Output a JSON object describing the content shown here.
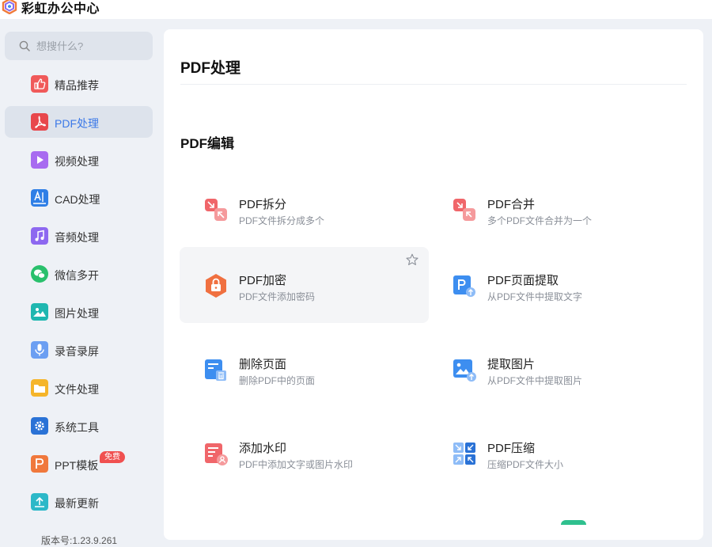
{
  "app": {
    "title": "彩虹办公中心"
  },
  "search": {
    "placeholder": "想搜什么?"
  },
  "sidebar": {
    "items": [
      {
        "label": "精品推荐",
        "icon": "thumbs-up-icon",
        "color": "#f05a5a"
      },
      {
        "label": "PDF处理",
        "icon": "pdf-icon",
        "color": "#e8474c",
        "active": true
      },
      {
        "label": "视频处理",
        "icon": "video-play-icon",
        "color": "#a86bf0"
      },
      {
        "label": "CAD处理",
        "icon": "cad-icon",
        "color": "#2f7fe6"
      },
      {
        "label": "音频处理",
        "icon": "music-note-icon",
        "color": "#8d68f0"
      },
      {
        "label": "微信多开",
        "icon": "wechat-icon",
        "color": "#29c06c"
      },
      {
        "label": "图片处理",
        "icon": "image-icon",
        "color": "#1fb7b0"
      },
      {
        "label": "录音录屏",
        "icon": "microphone-icon",
        "color": "#6c9ff2"
      },
      {
        "label": "文件处理",
        "icon": "folder-icon",
        "color": "#f5b52a"
      },
      {
        "label": "系统工具",
        "icon": "gear-icon",
        "color": "#2a72d6"
      },
      {
        "label": "PPT模板",
        "icon": "ppt-icon",
        "color": "#f0783c",
        "badge": "免费"
      },
      {
        "label": "最新更新",
        "icon": "upload-icon",
        "color": "#2cb8c8"
      }
    ],
    "version": "版本号:1.23.9.261"
  },
  "main": {
    "title": "PDF处理",
    "section": "PDF编辑",
    "tools": [
      {
        "title": "PDF拆分",
        "desc": "PDF文件拆分成多个",
        "icon": "pdf-split-icon",
        "color": "#f0666a"
      },
      {
        "title": "PDF合并",
        "desc": "多个PDF文件合并为一个",
        "icon": "pdf-merge-icon",
        "color": "#f0666a"
      },
      {
        "title": "PDF加密",
        "desc": "PDF文件添加密码",
        "icon": "pdf-lock-icon",
        "color": "#f07040"
      },
      {
        "title": "PDF页面提取",
        "desc": "从PDF文件中提取文字",
        "icon": "pdf-page-extract-icon",
        "color": "#3d8ef0"
      },
      {
        "title": "删除页面",
        "desc": "删除PDF中的页面",
        "icon": "delete-page-icon",
        "color": "#3d8ef0"
      },
      {
        "title": "提取图片",
        "desc": "从PDF文件中提取图片",
        "icon": "extract-image-icon",
        "color": "#3d8ef0"
      },
      {
        "title": "添加水印",
        "desc": "PDF中添加文字或图片水印",
        "icon": "watermark-icon",
        "color": "#f0666a"
      },
      {
        "title": "PDF压缩",
        "desc": "压缩PDF文件大小",
        "icon": "pdf-compress-icon",
        "color": "#3d8ef0"
      }
    ]
  }
}
